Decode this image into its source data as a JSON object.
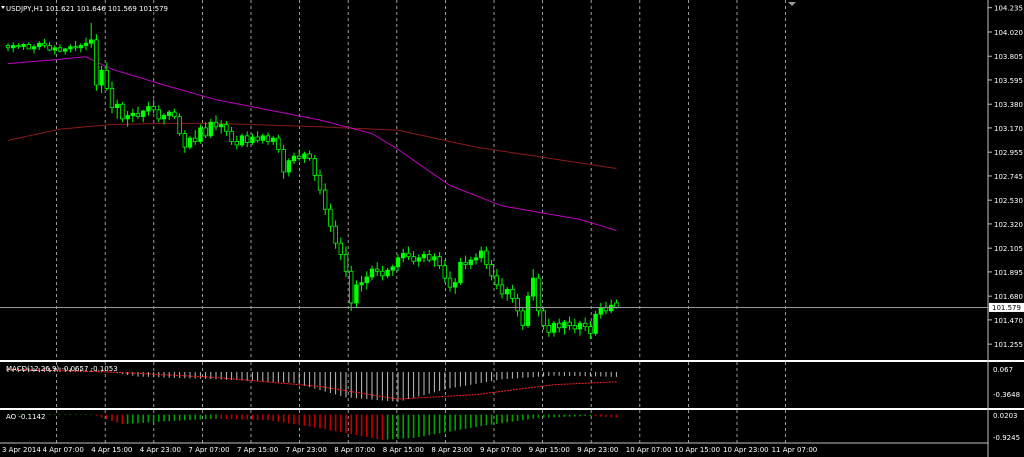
{
  "colors": {
    "background": "#000000",
    "grid": "#c0c0c0",
    "text": "#ffffff",
    "bull": "#00ff00",
    "bear": "#000000",
    "wick": "#00ff00",
    "ma_fast": "#c000c0",
    "ma_slow": "#8b1a1a",
    "macd_hist": "#c0c0c0",
    "macd_signal": "#ff2020",
    "ao_up": "#00a000",
    "ao_down": "#c00000",
    "price_line": "#9a9a9a",
    "separator": "#ffffff"
  },
  "main": {
    "title": "USDJPY,H1  101.621 101.646 101.569 101.579",
    "current_price_label": "101.579"
  },
  "macd_panel": {
    "title": "MACD(12,26,9) -0.0657 -0.1053",
    "scale_top": "0.067",
    "scale_bottom": "-0.3648"
  },
  "ao_panel": {
    "title": "AO -0.1142",
    "scale_top": "0.0203",
    "scale_bottom": "-0.9245"
  },
  "chart_data": {
    "type": "candlestick",
    "symbol": "USDJPY",
    "timeframe": "H1",
    "ylim": [
      101.15,
      104.25
    ],
    "y_ticks": [
      "104.235",
      "104.020",
      "103.805",
      "103.595",
      "103.380",
      "103.170",
      "102.955",
      "102.745",
      "102.530",
      "102.320",
      "102.105",
      "101.895",
      "101.680",
      "101.470",
      "101.255"
    ],
    "x_ticks": [
      "3 Apr 2014",
      "4 Apr 07:00",
      "4 Apr 15:00",
      "4 Apr 23:00",
      "7 Apr 07:00",
      "7 Apr 15:00",
      "7 Apr 23:00",
      "8 Apr 07:00",
      "8 Apr 15:00",
      "8 Apr 23:00",
      "9 Apr 07:00",
      "9 Apr 15:00",
      "9 Apr 23:00",
      "10 Apr 07:00",
      "10 Apr 15:00",
      "10 Apr 23:00",
      "11 Apr 07:00"
    ],
    "ma_fast_keys": [
      [
        0,
        103.74
      ],
      [
        8,
        103.77
      ],
      [
        15,
        103.8
      ],
      [
        20,
        103.69
      ],
      [
        30,
        103.55
      ],
      [
        40,
        103.42
      ],
      [
        50,
        103.33
      ],
      [
        60,
        103.24
      ],
      [
        70,
        103.12
      ],
      [
        75,
        102.98
      ],
      [
        85,
        102.66
      ],
      [
        95,
        102.48
      ],
      [
        110,
        102.36
      ],
      [
        120,
        102.22
      ],
      [
        130,
        102.08
      ],
      [
        140,
        101.94
      ],
      [
        148,
        101.84
      ]
    ],
    "ma_slow_keys": [
      [
        0,
        103.06
      ],
      [
        10,
        103.16
      ],
      [
        20,
        103.2
      ],
      [
        30,
        103.21
      ],
      [
        40,
        103.21
      ],
      [
        60,
        103.18
      ],
      [
        75,
        103.15
      ],
      [
        90,
        103.0
      ],
      [
        110,
        102.86
      ],
      [
        130,
        102.72
      ],
      [
        148,
        102.47
      ]
    ],
    "candles": [
      [
        103.9,
        103.92,
        103.85,
        103.88
      ],
      [
        103.88,
        103.93,
        103.84,
        103.9
      ],
      [
        103.9,
        103.92,
        103.87,
        103.89
      ],
      [
        103.89,
        103.92,
        103.86,
        103.91
      ],
      [
        103.91,
        103.93,
        103.88,
        103.87
      ],
      [
        103.87,
        103.91,
        103.83,
        103.89
      ],
      [
        103.89,
        103.94,
        103.86,
        103.92
      ],
      [
        103.92,
        103.96,
        103.88,
        103.9
      ],
      [
        103.9,
        103.93,
        103.85,
        103.86
      ],
      [
        103.86,
        103.9,
        103.82,
        103.88
      ],
      [
        103.88,
        103.91,
        103.84,
        103.85
      ],
      [
        103.85,
        103.88,
        103.82,
        103.87
      ],
      [
        103.87,
        103.91,
        103.84,
        103.89
      ],
      [
        103.89,
        103.94,
        103.85,
        103.88
      ],
      [
        103.88,
        103.92,
        103.84,
        103.9
      ],
      [
        103.9,
        103.97,
        103.86,
        103.92
      ],
      [
        103.92,
        104.1,
        103.88,
        103.95
      ],
      [
        103.95,
        104.0,
        103.5,
        103.55
      ],
      [
        103.55,
        103.72,
        103.48,
        103.68
      ],
      [
        103.68,
        103.75,
        103.5,
        103.52
      ],
      [
        103.52,
        103.58,
        103.3,
        103.35
      ],
      [
        103.35,
        103.42,
        103.25,
        103.38
      ],
      [
        103.38,
        103.4,
        103.22,
        103.25
      ],
      [
        103.25,
        103.32,
        103.18,
        103.28
      ],
      [
        103.28,
        103.34,
        103.22,
        103.3
      ],
      [
        103.3,
        103.36,
        103.25,
        103.27
      ],
      [
        103.27,
        103.33,
        103.22,
        103.32
      ],
      [
        103.32,
        103.4,
        103.28,
        103.36
      ],
      [
        103.36,
        103.42,
        103.3,
        103.33
      ],
      [
        103.33,
        103.37,
        103.22,
        103.25
      ],
      [
        103.25,
        103.3,
        103.2,
        103.28
      ],
      [
        103.28,
        103.33,
        103.24,
        103.31
      ],
      [
        103.31,
        103.34,
        103.25,
        103.27
      ],
      [
        103.27,
        103.3,
        103.1,
        103.12
      ],
      [
        103.12,
        103.15,
        102.95,
        103.0
      ],
      [
        103.0,
        103.1,
        102.98,
        103.08
      ],
      [
        103.08,
        103.15,
        103.02,
        103.05
      ],
      [
        103.05,
        103.2,
        103.03,
        103.17
      ],
      [
        103.17,
        103.22,
        103.08,
        103.1
      ],
      [
        103.1,
        103.25,
        103.08,
        103.22
      ],
      [
        103.22,
        103.28,
        103.15,
        103.18
      ],
      [
        103.18,
        103.24,
        103.12,
        103.2
      ],
      [
        103.2,
        103.23,
        103.1,
        103.14
      ],
      [
        103.14,
        103.18,
        103.02,
        103.05
      ],
      [
        103.05,
        103.1,
        102.98,
        103.02
      ],
      [
        103.02,
        103.12,
        103.0,
        103.1
      ],
      [
        103.1,
        103.14,
        103.0,
        103.04
      ],
      [
        103.04,
        103.12,
        103.02,
        103.09
      ],
      [
        103.09,
        103.14,
        103.04,
        103.06
      ],
      [
        103.06,
        103.12,
        103.03,
        103.1
      ],
      [
        103.1,
        103.13,
        103.02,
        103.05
      ],
      [
        103.05,
        103.1,
        103.02,
        103.08
      ],
      [
        103.08,
        103.11,
        102.95,
        102.98
      ],
      [
        102.98,
        103.02,
        102.72,
        102.78
      ],
      [
        102.78,
        102.9,
        102.74,
        102.88
      ],
      [
        102.88,
        102.95,
        102.85,
        102.92
      ],
      [
        102.92,
        102.98,
        102.88,
        102.9
      ],
      [
        102.9,
        102.96,
        102.86,
        102.94
      ],
      [
        102.94,
        102.97,
        102.88,
        102.9
      ],
      [
        102.9,
        102.93,
        102.7,
        102.75
      ],
      [
        102.75,
        102.8,
        102.58,
        102.62
      ],
      [
        102.62,
        102.68,
        102.4,
        102.45
      ],
      [
        102.45,
        102.5,
        102.25,
        102.3
      ],
      [
        102.3,
        102.35,
        102.1,
        102.15
      ],
      [
        102.15,
        102.2,
        102.0,
        102.05
      ],
      [
        102.05,
        102.12,
        101.85,
        101.9
      ],
      [
        101.9,
        101.95,
        101.55,
        101.62
      ],
      [
        101.62,
        101.82,
        101.58,
        101.78
      ],
      [
        101.78,
        101.86,
        101.72,
        101.8
      ],
      [
        101.8,
        101.9,
        101.74,
        101.85
      ],
      [
        101.85,
        101.95,
        101.82,
        101.92
      ],
      [
        101.92,
        101.98,
        101.86,
        101.9
      ],
      [
        101.9,
        101.95,
        101.82,
        101.86
      ],
      [
        101.86,
        101.93,
        101.84,
        101.91
      ],
      [
        101.91,
        101.96,
        101.86,
        101.94
      ],
      [
        101.94,
        102.05,
        101.9,
        102.02
      ],
      [
        102.02,
        102.1,
        101.98,
        102.06
      ],
      [
        102.06,
        102.12,
        102.0,
        102.03
      ],
      [
        102.03,
        102.08,
        101.96,
        101.99
      ],
      [
        101.99,
        102.05,
        101.94,
        102.02
      ],
      [
        102.02,
        102.08,
        101.98,
        102.05
      ],
      [
        102.05,
        102.09,
        101.98,
        102.0
      ],
      [
        102.0,
        102.06,
        101.94,
        102.03
      ],
      [
        102.03,
        102.07,
        101.92,
        101.95
      ],
      [
        101.95,
        102.0,
        101.8,
        101.84
      ],
      [
        101.84,
        101.9,
        101.72,
        101.76
      ],
      [
        101.76,
        101.84,
        101.7,
        101.8
      ],
      [
        101.8,
        102.02,
        101.78,
        101.98
      ],
      [
        101.98,
        102.04,
        101.92,
        101.96
      ],
      [
        101.96,
        102.03,
        101.92,
        102.0
      ],
      [
        102.0,
        102.06,
        101.96,
        102.02
      ],
      [
        102.02,
        102.12,
        101.98,
        102.08
      ],
      [
        102.08,
        102.12,
        101.92,
        101.96
      ],
      [
        101.96,
        102.0,
        101.82,
        101.86
      ],
      [
        101.86,
        101.92,
        101.74,
        101.78
      ],
      [
        101.78,
        101.84,
        101.66,
        101.7
      ],
      [
        101.7,
        101.76,
        101.64,
        101.74
      ],
      [
        101.74,
        101.78,
        101.62,
        101.66
      ],
      [
        101.66,
        101.7,
        101.5,
        101.55
      ],
      [
        101.55,
        101.58,
        101.38,
        101.42
      ],
      [
        101.42,
        101.72,
        101.4,
        101.68
      ],
      [
        101.68,
        101.92,
        101.64,
        101.84
      ],
      [
        101.84,
        101.88,
        101.5,
        101.55
      ],
      [
        101.55,
        101.58,
        101.38,
        101.42
      ],
      [
        101.42,
        101.48,
        101.32,
        101.36
      ],
      [
        101.36,
        101.46,
        101.32,
        101.44
      ],
      [
        101.44,
        101.48,
        101.36,
        101.4
      ],
      [
        101.4,
        101.47,
        101.34,
        101.45
      ],
      [
        101.45,
        101.5,
        101.38,
        101.42
      ],
      [
        101.42,
        101.48,
        101.35,
        101.39
      ],
      [
        101.39,
        101.46,
        101.33,
        101.44
      ],
      [
        101.44,
        101.49,
        101.37,
        101.41
      ],
      [
        101.41,
        101.46,
        101.3,
        101.35
      ],
      [
        101.35,
        101.55,
        101.33,
        101.52
      ],
      [
        101.52,
        101.62,
        101.48,
        101.58
      ],
      [
        101.58,
        101.63,
        101.52,
        101.55
      ],
      [
        101.55,
        101.65,
        101.53,
        101.6
      ],
      [
        101.62,
        101.65,
        101.57,
        101.58
      ]
    ],
    "macd_hist_keys": [
      [
        0,
        0.04
      ],
      [
        10,
        0.05
      ],
      [
        17,
        0.02
      ],
      [
        25,
        -0.05
      ],
      [
        40,
        -0.08
      ],
      [
        55,
        -0.12
      ],
      [
        65,
        -0.28
      ],
      [
        75,
        -0.33
      ],
      [
        85,
        -0.18
      ],
      [
        95,
        -0.08
      ],
      [
        105,
        -0.04
      ],
      [
        115,
        -0.05
      ],
      [
        125,
        -0.07
      ],
      [
        135,
        -0.08
      ],
      [
        149,
        -0.065
      ]
    ],
    "macd_signal_keys": [
      [
        0,
        0.03
      ],
      [
        20,
        0.0
      ],
      [
        40,
        -0.06
      ],
      [
        60,
        -0.16
      ],
      [
        75,
        -0.3
      ],
      [
        90,
        -0.25
      ],
      [
        105,
        -0.14
      ],
      [
        120,
        -0.1
      ],
      [
        135,
        -0.11
      ],
      [
        149,
        -0.105
      ]
    ],
    "ao_keys": [
      [
        0,
        0.02
      ],
      [
        16,
        0.02
      ],
      [
        22,
        -0.35
      ],
      [
        30,
        -0.25
      ],
      [
        40,
        -0.15
      ],
      [
        50,
        -0.2
      ],
      [
        60,
        -0.5
      ],
      [
        72,
        -0.92
      ],
      [
        78,
        -0.85
      ],
      [
        90,
        -0.45
      ],
      [
        102,
        -0.12
      ],
      [
        112,
        -0.05
      ],
      [
        122,
        -0.18
      ],
      [
        132,
        -0.3
      ],
      [
        142,
        -0.25
      ],
      [
        149,
        -0.11
      ]
    ]
  }
}
